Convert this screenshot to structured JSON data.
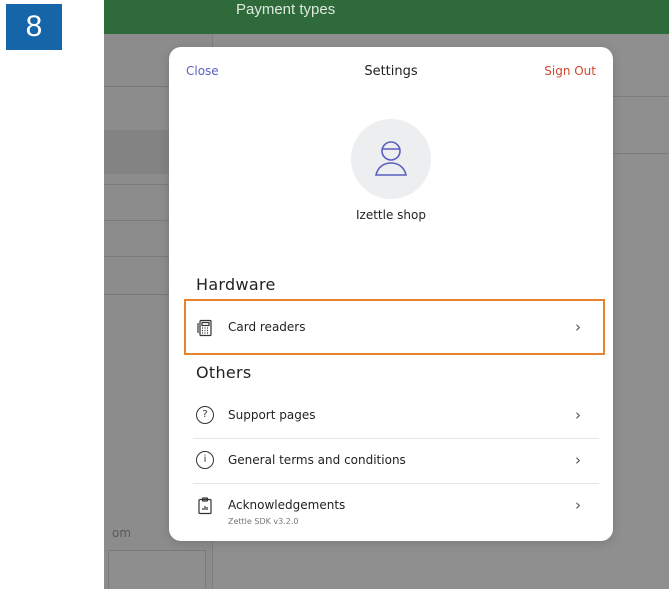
{
  "step": {
    "number": "8"
  },
  "background": {
    "header_title": "Payment types",
    "sidebar_fragment": "om"
  },
  "modal": {
    "close_label": "Close",
    "title": "Settings",
    "sign_out_label": "Sign Out",
    "shop_name": "Izettle shop",
    "sections": [
      {
        "title": "Hardware",
        "items": [
          {
            "label": "Card readers",
            "icon": "card-reader-icon",
            "highlighted": true
          }
        ]
      },
      {
        "title": "Others",
        "items": [
          {
            "label": "Support pages",
            "icon": "help-circle-icon"
          },
          {
            "label": "General terms and conditions",
            "icon": "info-circle-icon"
          },
          {
            "label": "Acknowledgements",
            "sublabel": "Zettle SDK v3.2.0",
            "icon": "clipboard-icon"
          }
        ]
      }
    ]
  },
  "colors": {
    "accent_link": "#5a5fc0",
    "sign_out": "#d0472f",
    "highlight": "#e7832f",
    "step_badge": "#1565a8",
    "header_green": "#2f6b3a"
  }
}
